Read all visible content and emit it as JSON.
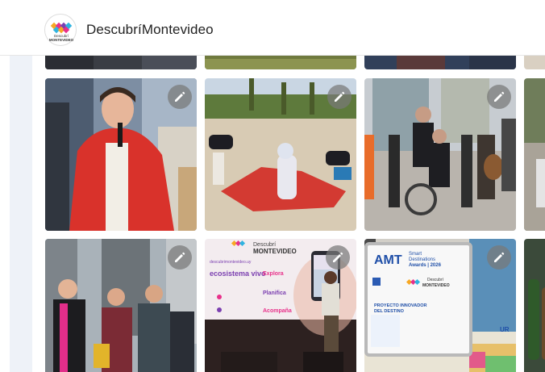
{
  "header": {
    "logo": {
      "text_top": "Descubrí",
      "text_bottom": "MONTEVIDEO",
      "icon": "diamond-cluster-logo"
    },
    "site_title": "DescubríMontevideo"
  },
  "photos": {
    "edit_icon": "pencil-icon",
    "row2_center": {
      "brand_top": "Descubrí",
      "brand_bottom": "MONTEVIDEO",
      "headline": "ecosistema vivo",
      "items": [
        "Explora",
        "Planifica",
        "Acompaña"
      ],
      "url": "descubrimontevideo.uy"
    },
    "row2_right": {
      "brand": "AMT",
      "award_line1": "Smart",
      "award_line2": "Destinations",
      "award_line3": "Awards | 2026",
      "logo_top": "Descubrí",
      "logo_bottom": "MONTEVIDEO",
      "label": "PROYECTO INNOVADOR",
      "label2": "DEL DESTINO",
      "corner": "UR"
    }
  }
}
